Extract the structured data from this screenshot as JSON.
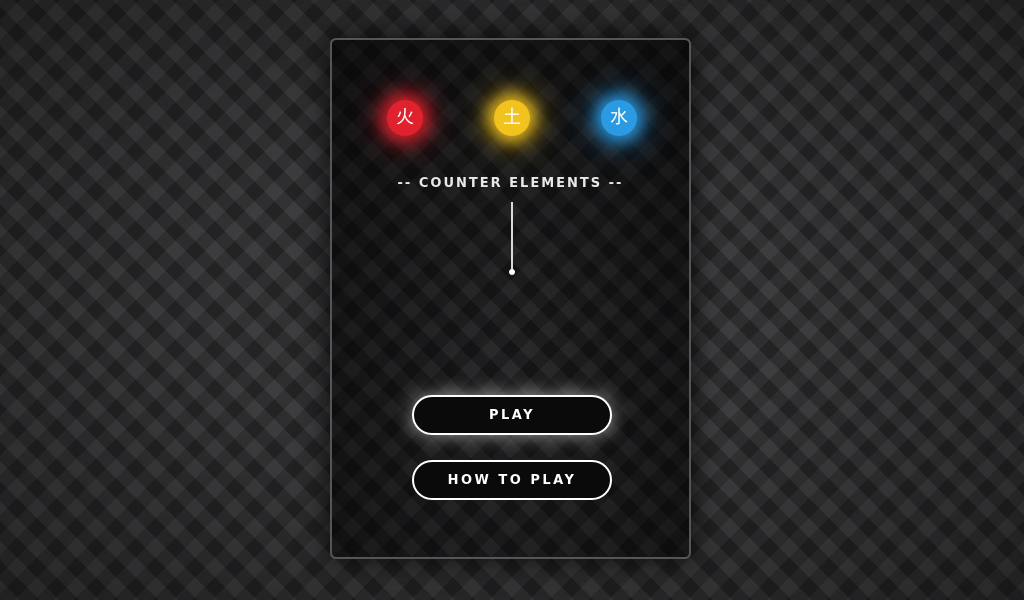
{
  "elements": [
    {
      "name": "fire",
      "glyph": "火",
      "color": "#e0222e",
      "glow": "rgba(224,34,46,0.9)"
    },
    {
      "name": "earth",
      "glyph": "土",
      "color": "#f2c21f",
      "glow": "rgba(242,194,31,0.9)"
    },
    {
      "name": "water",
      "glyph": "水",
      "color": "#2a9be3",
      "glow": "rgba(42,155,227,0.9)"
    }
  ],
  "title": "-- COUNTER ELEMENTS --",
  "buttons": {
    "play_label": "PLAY",
    "how_to_play_label": "HOW TO PLAY"
  },
  "theme": {
    "panel_border": "#555558",
    "button_border": "#ffffff",
    "text": "#e9e9ea"
  }
}
